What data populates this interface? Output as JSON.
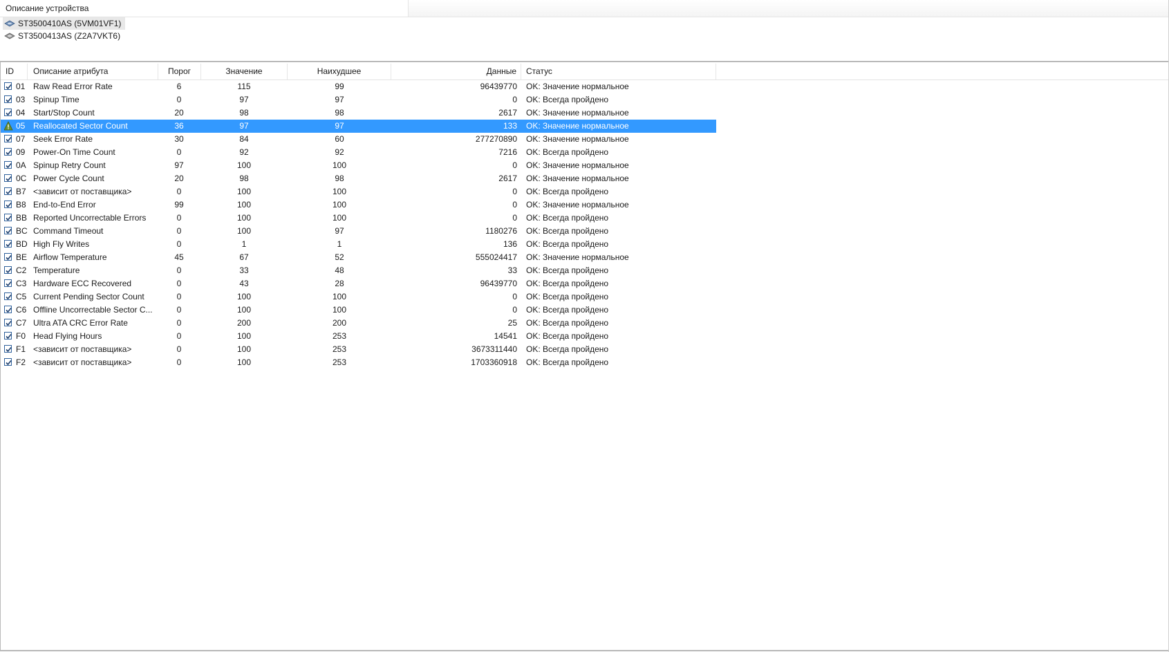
{
  "devices_panel": {
    "header_label": "Описание устройства",
    "devices": [
      {
        "label": "ST3500410AS (5VM01VF1)",
        "selected": true
      },
      {
        "label": "ST3500413AS (Z2A7VKT6)",
        "selected": false
      }
    ]
  },
  "table": {
    "columns": {
      "id": "ID",
      "name": "Описание атрибута",
      "threshold": "Порог",
      "value": "Значение",
      "worst": "Наихудшее",
      "data": "Данные",
      "status": "Статус"
    },
    "selected_row_index": 3,
    "rows": [
      {
        "icon": "checkbox",
        "id": "01",
        "name": "Raw Read Error Rate",
        "threshold": "6",
        "value": "115",
        "worst": "99",
        "data": "96439770",
        "status": "OK: Значение нормальное"
      },
      {
        "icon": "checkbox",
        "id": "03",
        "name": "Spinup Time",
        "threshold": "0",
        "value": "97",
        "worst": "97",
        "data": "0",
        "status": "OK: Всегда пройдено"
      },
      {
        "icon": "checkbox",
        "id": "04",
        "name": "Start/Stop Count",
        "threshold": "20",
        "value": "98",
        "worst": "98",
        "data": "2617",
        "status": "OK: Значение нормальное"
      },
      {
        "icon": "warning",
        "id": "05",
        "name": "Reallocated Sector Count",
        "threshold": "36",
        "value": "97",
        "worst": "97",
        "data": "133",
        "status": "OK: Значение нормальное"
      },
      {
        "icon": "checkbox",
        "id": "07",
        "name": "Seek Error Rate",
        "threshold": "30",
        "value": "84",
        "worst": "60",
        "data": "277270890",
        "status": "OK: Значение нормальное"
      },
      {
        "icon": "checkbox",
        "id": "09",
        "name": "Power-On Time Count",
        "threshold": "0",
        "value": "92",
        "worst": "92",
        "data": "7216",
        "status": "OK: Всегда пройдено"
      },
      {
        "icon": "checkbox",
        "id": "0A",
        "name": "Spinup Retry Count",
        "threshold": "97",
        "value": "100",
        "worst": "100",
        "data": "0",
        "status": "OK: Значение нормальное"
      },
      {
        "icon": "checkbox",
        "id": "0C",
        "name": "Power Cycle Count",
        "threshold": "20",
        "value": "98",
        "worst": "98",
        "data": "2617",
        "status": "OK: Значение нормальное"
      },
      {
        "icon": "checkbox",
        "id": "B7",
        "name": "<зависит от поставщика>",
        "threshold": "0",
        "value": "100",
        "worst": "100",
        "data": "0",
        "status": "OK: Всегда пройдено"
      },
      {
        "icon": "checkbox",
        "id": "B8",
        "name": "End-to-End Error",
        "threshold": "99",
        "value": "100",
        "worst": "100",
        "data": "0",
        "status": "OK: Значение нормальное"
      },
      {
        "icon": "checkbox",
        "id": "BB",
        "name": "Reported Uncorrectable Errors",
        "threshold": "0",
        "value": "100",
        "worst": "100",
        "data": "0",
        "status": "OK: Всегда пройдено"
      },
      {
        "icon": "checkbox",
        "id": "BC",
        "name": "Command Timeout",
        "threshold": "0",
        "value": "100",
        "worst": "97",
        "data": "1180276",
        "status": "OK: Всегда пройдено"
      },
      {
        "icon": "checkbox",
        "id": "BD",
        "name": "High Fly Writes",
        "threshold": "0",
        "value": "1",
        "worst": "1",
        "data": "136",
        "status": "OK: Всегда пройдено"
      },
      {
        "icon": "checkbox",
        "id": "BE",
        "name": "Airflow Temperature",
        "threshold": "45",
        "value": "67",
        "worst": "52",
        "data": "555024417",
        "status": "OK: Значение нормальное"
      },
      {
        "icon": "checkbox",
        "id": "C2",
        "name": "Temperature",
        "threshold": "0",
        "value": "33",
        "worst": "48",
        "data": "33",
        "status": "OK: Всегда пройдено"
      },
      {
        "icon": "checkbox",
        "id": "C3",
        "name": "Hardware ECC Recovered",
        "threshold": "0",
        "value": "43",
        "worst": "28",
        "data": "96439770",
        "status": "OK: Всегда пройдено"
      },
      {
        "icon": "checkbox",
        "id": "C5",
        "name": "Current Pending Sector Count",
        "threshold": "0",
        "value": "100",
        "worst": "100",
        "data": "0",
        "status": "OK: Всегда пройдено"
      },
      {
        "icon": "checkbox",
        "id": "C6",
        "name": "Offline Uncorrectable Sector C...",
        "threshold": "0",
        "value": "100",
        "worst": "100",
        "data": "0",
        "status": "OK: Всегда пройдено"
      },
      {
        "icon": "checkbox",
        "id": "C7",
        "name": "Ultra ATA CRC Error Rate",
        "threshold": "0",
        "value": "200",
        "worst": "200",
        "data": "25",
        "status": "OK: Всегда пройдено"
      },
      {
        "icon": "checkbox",
        "id": "F0",
        "name": "Head Flying Hours",
        "threshold": "0",
        "value": "100",
        "worst": "253",
        "data": "14541",
        "status": "OK: Всегда пройдено"
      },
      {
        "icon": "checkbox",
        "id": "F1",
        "name": "<зависит от поставщика>",
        "threshold": "0",
        "value": "100",
        "worst": "253",
        "data": "3673311440",
        "status": "OK: Всегда пройдено"
      },
      {
        "icon": "checkbox",
        "id": "F2",
        "name": "<зависит от поставщика>",
        "threshold": "0",
        "value": "100",
        "worst": "253",
        "data": "1703360918",
        "status": "OK: Всегда пройдено"
      }
    ]
  }
}
